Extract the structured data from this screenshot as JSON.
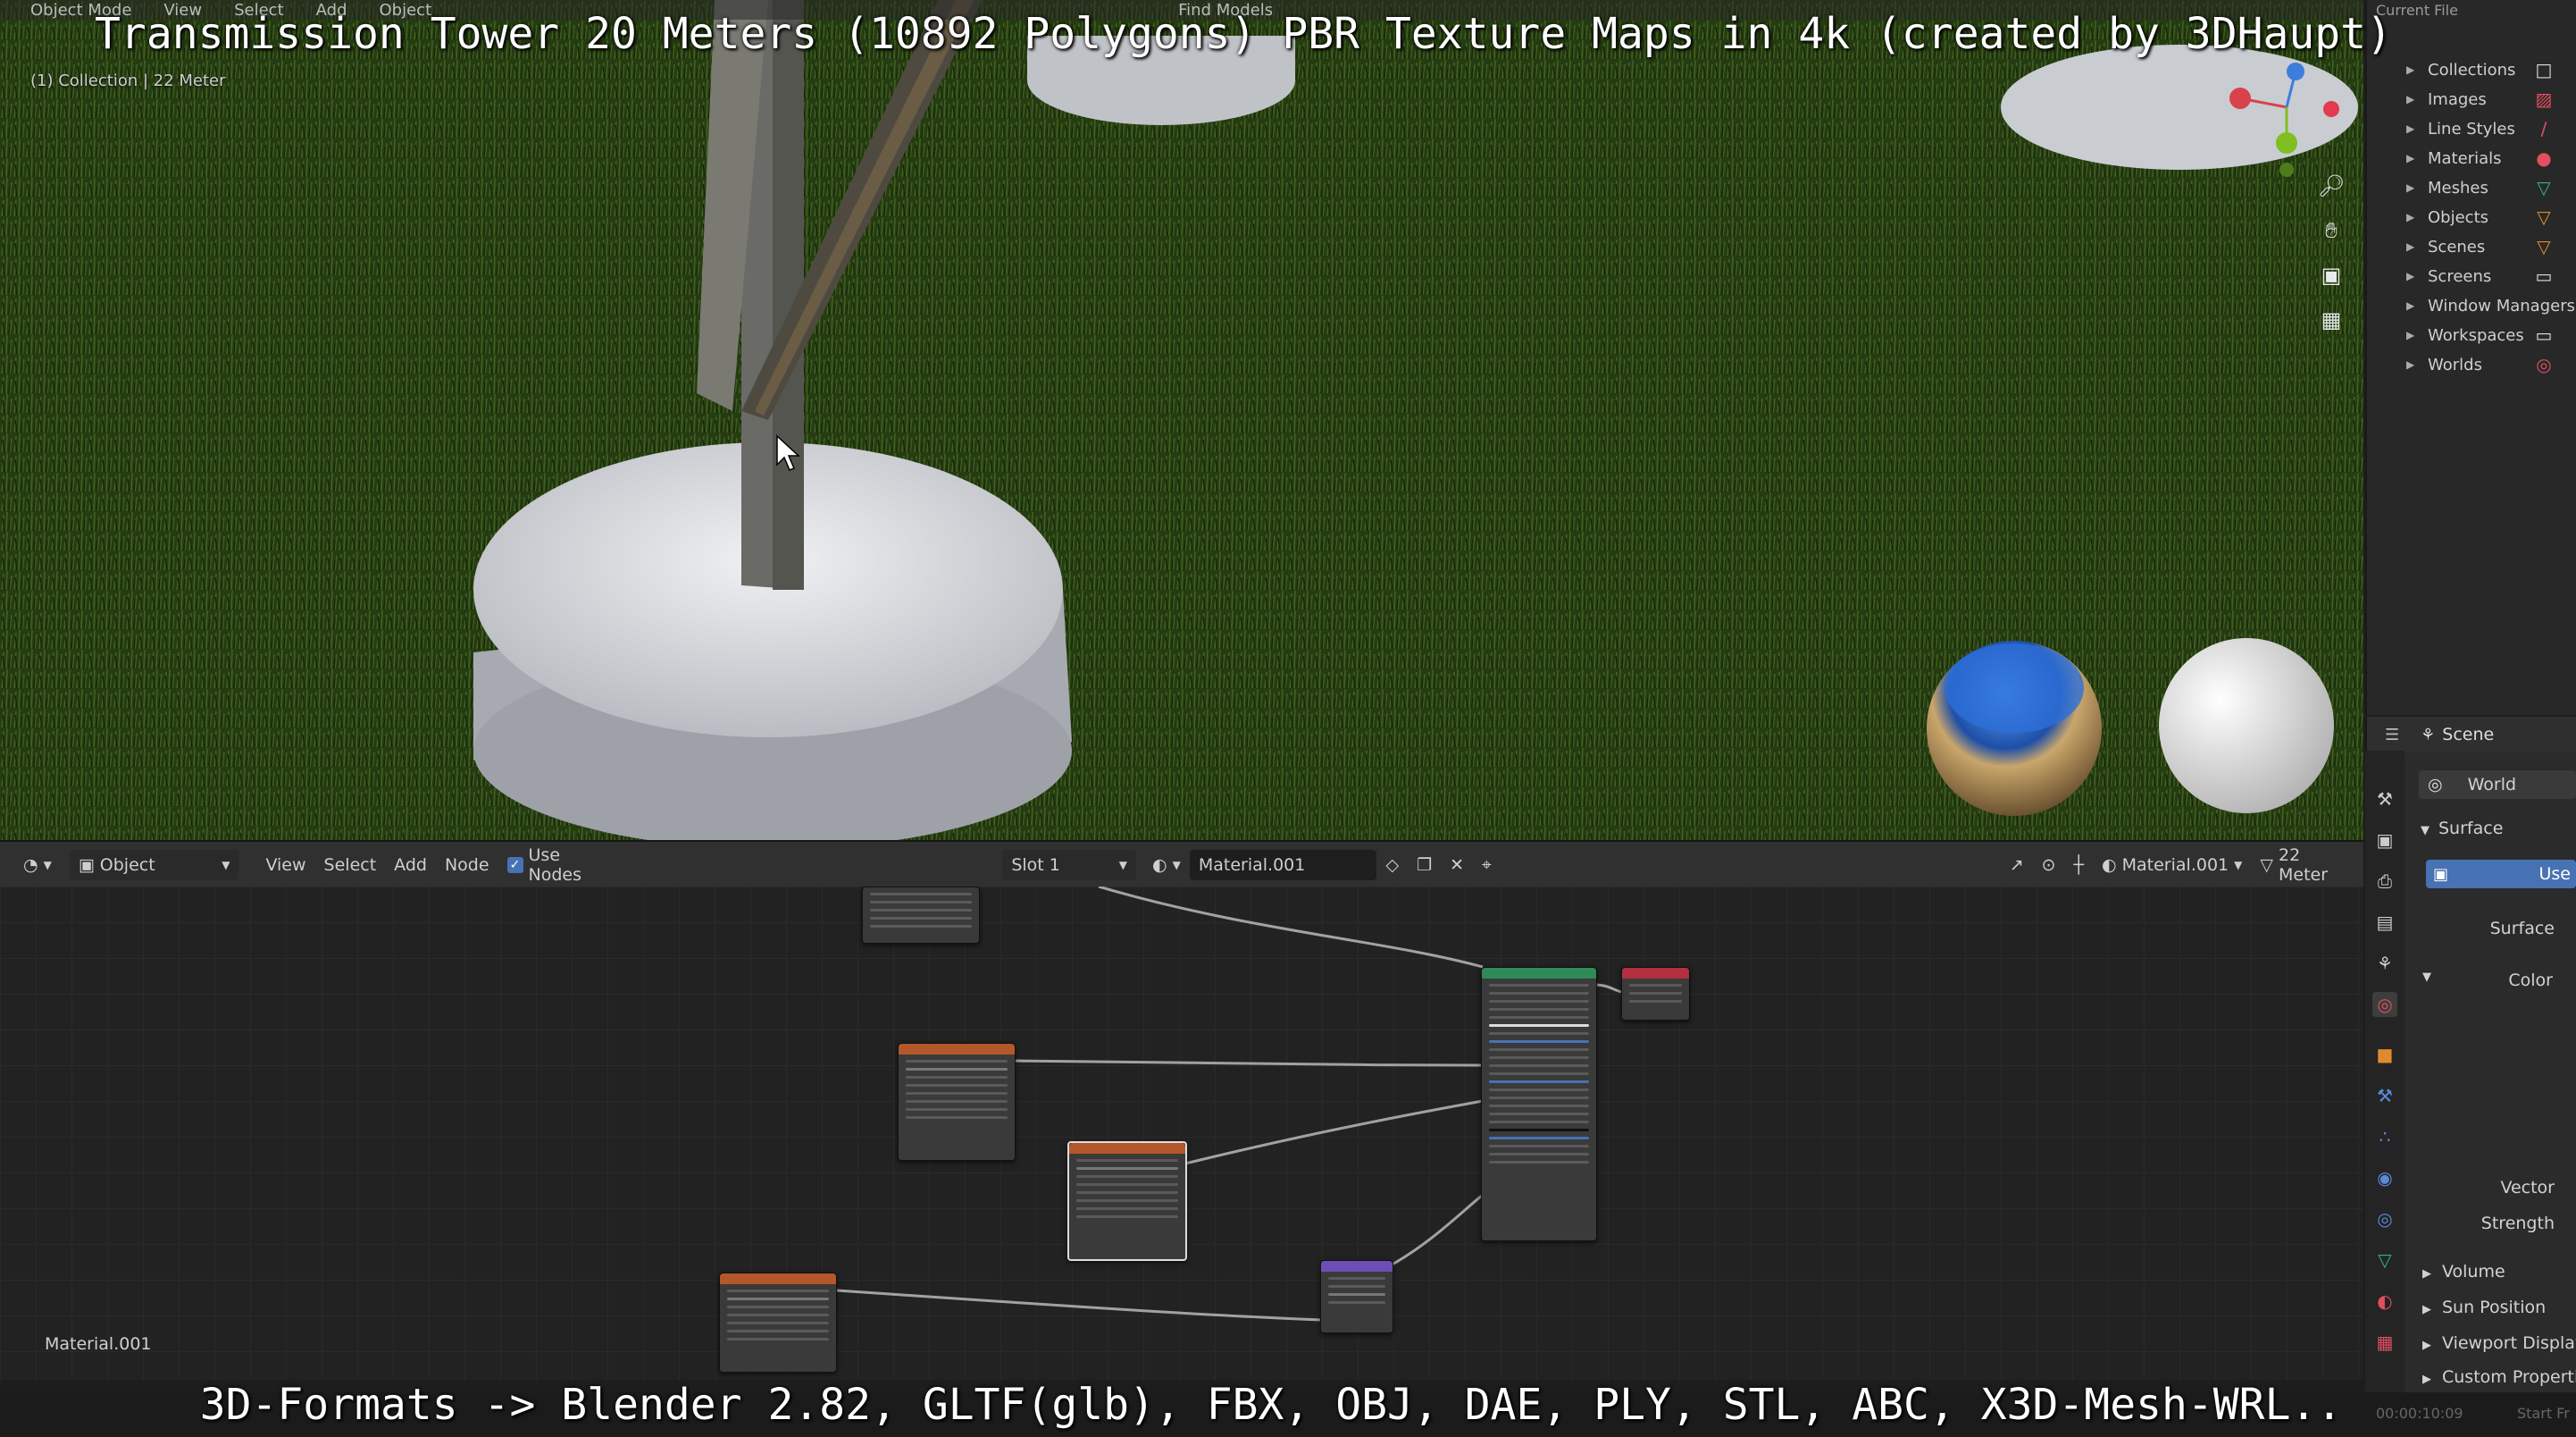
{
  "captions": {
    "top": "Transmission Tower 20 Meters (10892 Polygons) PBR Texture Maps in 4k (created by 3DHaupt)",
    "bottom": "3D-Formats -> Blender 2.82, GLTF(glb), FBX, OBJ, DAE, PLY, STL, ABC, X3D-Mesh-WRL.."
  },
  "viewport": {
    "header_items": [
      "Object Mode",
      "View",
      "Select",
      "Add",
      "Object",
      "Find Models"
    ],
    "info_line": "(1) Collection | 22 Meter",
    "nav_icons": [
      "zoom-icon",
      "hand-pan-icon",
      "camera-icon",
      "grid-icon"
    ]
  },
  "outliner": {
    "title": "Current File",
    "items": [
      {
        "label": "Collections",
        "icon": "collection-icon"
      },
      {
        "label": "Images",
        "icon": "image-icon"
      },
      {
        "label": "Line Styles",
        "icon": "linestyle-icon"
      },
      {
        "label": "Materials",
        "icon": "material-icon"
      },
      {
        "label": "Meshes",
        "icon": "mesh-icon"
      },
      {
        "label": "Objects",
        "icon": "object-icon"
      },
      {
        "label": "Scenes",
        "icon": "scene-icon"
      },
      {
        "label": "Screens",
        "icon": "screen-icon"
      },
      {
        "label": "Window Managers",
        "icon": "window-icon"
      },
      {
        "label": "Workspaces",
        "icon": "workspace-icon"
      },
      {
        "label": "Worlds",
        "icon": "world-icon"
      }
    ]
  },
  "properties": {
    "scene_label": "Scene",
    "world_label": "World",
    "surface_section": "Surface",
    "use_nodes_button": "Use",
    "surface_label": "Surface",
    "color_label": "Color",
    "vector_label": "Vector",
    "strength_label": "Strength",
    "sections": [
      "Volume",
      "Sun Position",
      "Viewport Display",
      "Custom Properties"
    ]
  },
  "node_editor": {
    "editor_type": "Object",
    "menus": [
      "View",
      "Select",
      "Add",
      "Node"
    ],
    "use_nodes_label": "Use Nodes",
    "use_nodes_checked": true,
    "slot": "Slot 1",
    "material_name": "Material.001",
    "right_material": "Material.001",
    "right_object": "22 Meter",
    "bottom_label": "Material.001"
  },
  "status": {
    "timecode": "00:00:10:09",
    "start_frame": "Start Fr"
  },
  "colors": {
    "accent_blue": "#4772b3",
    "node_image": "#b4582b",
    "node_bsdf": "#2e8b57",
    "node_output": "#b33040",
    "node_normal": "#6b4fb5",
    "grass": "#2f4a18",
    "concrete": "#dcdde0"
  }
}
